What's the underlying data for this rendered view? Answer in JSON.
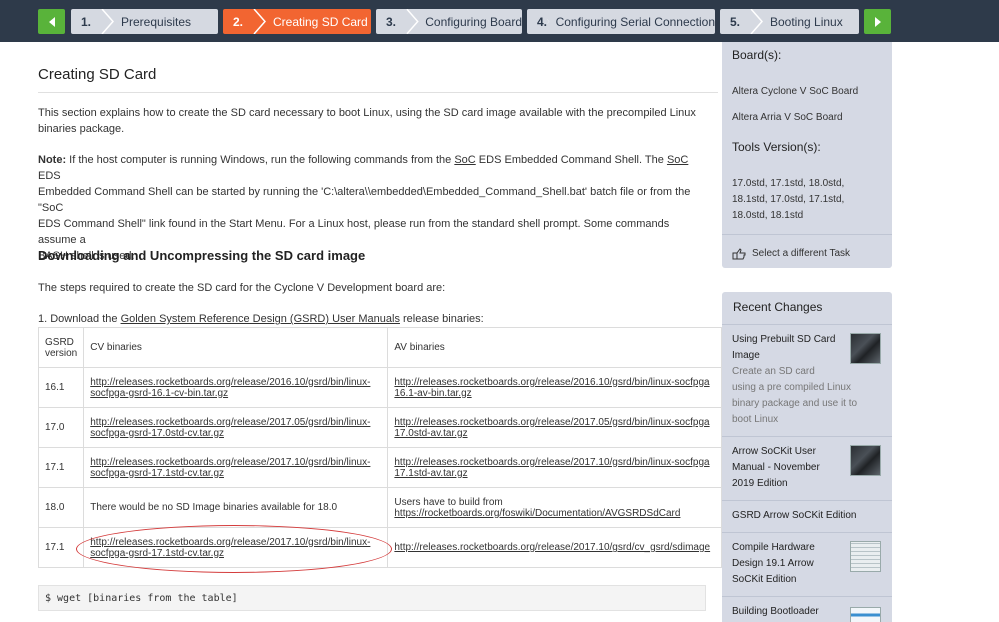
{
  "step_nav": {
    "steps": [
      {
        "num": "1.",
        "label": "Prerequisites"
      },
      {
        "num": "2.",
        "label": "Creating SD Card"
      },
      {
        "num": "3.",
        "label": "Configuring Board"
      },
      {
        "num": "4.",
        "label": "Configuring Serial Connection"
      },
      {
        "num": "5.",
        "label": "Booting Linux"
      }
    ],
    "active_index": 1,
    "colors": {
      "bar": "#2e3a4a",
      "active": "#f26531",
      "inactive": "#d5d9e1",
      "arrows": "#59b33a"
    },
    "prev_icon": "chevron-left-icon",
    "next_icon": "chevron-right-icon"
  },
  "main": {
    "title": "Creating SD Card",
    "intro_1": "This section explains how to create the SD card necessary to boot Linux, using the SD card image available with the precompiled Linux",
    "intro_2": "binaries package.",
    "note": {
      "label": "Note:",
      "line1_a": " If the host computer is running Windows, run the following commands from the ",
      "soc1": "SoC",
      "line1_b": " EDS Embedded Command Shell. The ",
      "soc2": "SoC",
      "line1_c": " EDS",
      "line2": "Embedded Command Shell can be started by running the 'C:\\altera\\\\embedded\\Embedded_Command_Shell.bat' batch file or from the \"SoC",
      "line3": "EDS Command Shell\" link found in the Start Menu. For a Linux host, please run from the standard shell prompt. Some commands assume a",
      "line4": "BASH shell is used."
    },
    "section_heading": "Downloading and Uncompressing the SD card image",
    "steps_intro": "The steps required to create the SD card for the Cyclone V Development board are:",
    "download_step": {
      "prefix": "1. Download the ",
      "link": "Golden System Reference Design (GSRD) User Manuals",
      "suffix": " release binaries:"
    },
    "table": {
      "headers": [
        "GSRD version",
        "CV binaries",
        "AV binaries"
      ],
      "rows": [
        {
          "version": "16.1",
          "cv": [
            "http://releases.rocketboards.org/release/2016.10/gsrd/bin/linux-",
            "socfpga-gsrd-16.1-cv-bin.tar.gz"
          ],
          "av": [
            "http://releases.rocketboards.org/release/2016.10/gsrd/bin/linux-socfpga",
            "16.1-av-bin.tar.gz"
          ]
        },
        {
          "version": "17.0",
          "cv": [
            "http://releases.rocketboards.org/release/2017.05/gsrd/bin/linux-",
            "socfpga-gsrd-17.0std-cv.tar.gz"
          ],
          "av": [
            "http://releases.rocketboards.org/release/2017.05/gsrd/bin/linux-socfpga",
            "17.0std-av.tar.gz"
          ]
        },
        {
          "version": "17.1",
          "cv": [
            "http://releases.rocketboards.org/release/2017.10/gsrd/bin/linux-",
            "socfpga-gsrd-17.1std-cv.tar.gz"
          ],
          "av": [
            "http://releases.rocketboards.org/release/2017.10/gsrd/bin/linux-socfpga",
            "17.1std-av.tar.gz"
          ]
        },
        {
          "version": "18.0",
          "cv_text": "There would be no SD Image binaries available for 18.0",
          "av_text": "Users have to build from",
          "av_link": "https://rocketboards.org/foswiki/Documentation/AVGSRDSdCard"
        },
        {
          "version": "17.1",
          "cv": [
            "http://releases.rocketboards.org/release/2017.10/gsrd/bin/linux-",
            "socfpga-gsrd-17.1std-cv.tar.gz"
          ],
          "av_single": "http://releases.rocketboards.org/release/2017.10/gsrd/cv_gsrd/sdimage"
        }
      ]
    },
    "code": "$ wget [binaries from the table]"
  },
  "sidebar": {
    "boards_heading": "Board(s):",
    "boards": [
      "Altera Cyclone V SoC Board",
      "Altera Arria V SoC Board"
    ],
    "tools_heading": "Tools Version(s):",
    "tools_lines": [
      "17.0std, 17.1std, 18.0std,",
      "18.1std, 17.0std, 17.1std,",
      "18.0std, 18.1std"
    ],
    "select_task": "Select a different Task",
    "select_task_icon": "hand-pointer-icon",
    "recent_title": "Recent Changes",
    "recent": [
      {
        "title": [
          "Using Prebuilt SD Card",
          "Image"
        ],
        "desc": [
          "Create an SD card",
          "using a pre compiled Linux",
          "binary package and use it to",
          "boot Linux"
        ]
      },
      {
        "title": [
          "Arrow SoCKit User",
          "Manual - November",
          "2019 Edition"
        ]
      },
      {
        "title": [
          "GSRD Arrow SoCKit Edition"
        ]
      },
      {
        "title": [
          "Compile Hardware",
          "Design 19.1 Arrow",
          "SoCKit Edition"
        ]
      },
      {
        "title": [
          "Building Bootloader"
        ]
      }
    ]
  }
}
